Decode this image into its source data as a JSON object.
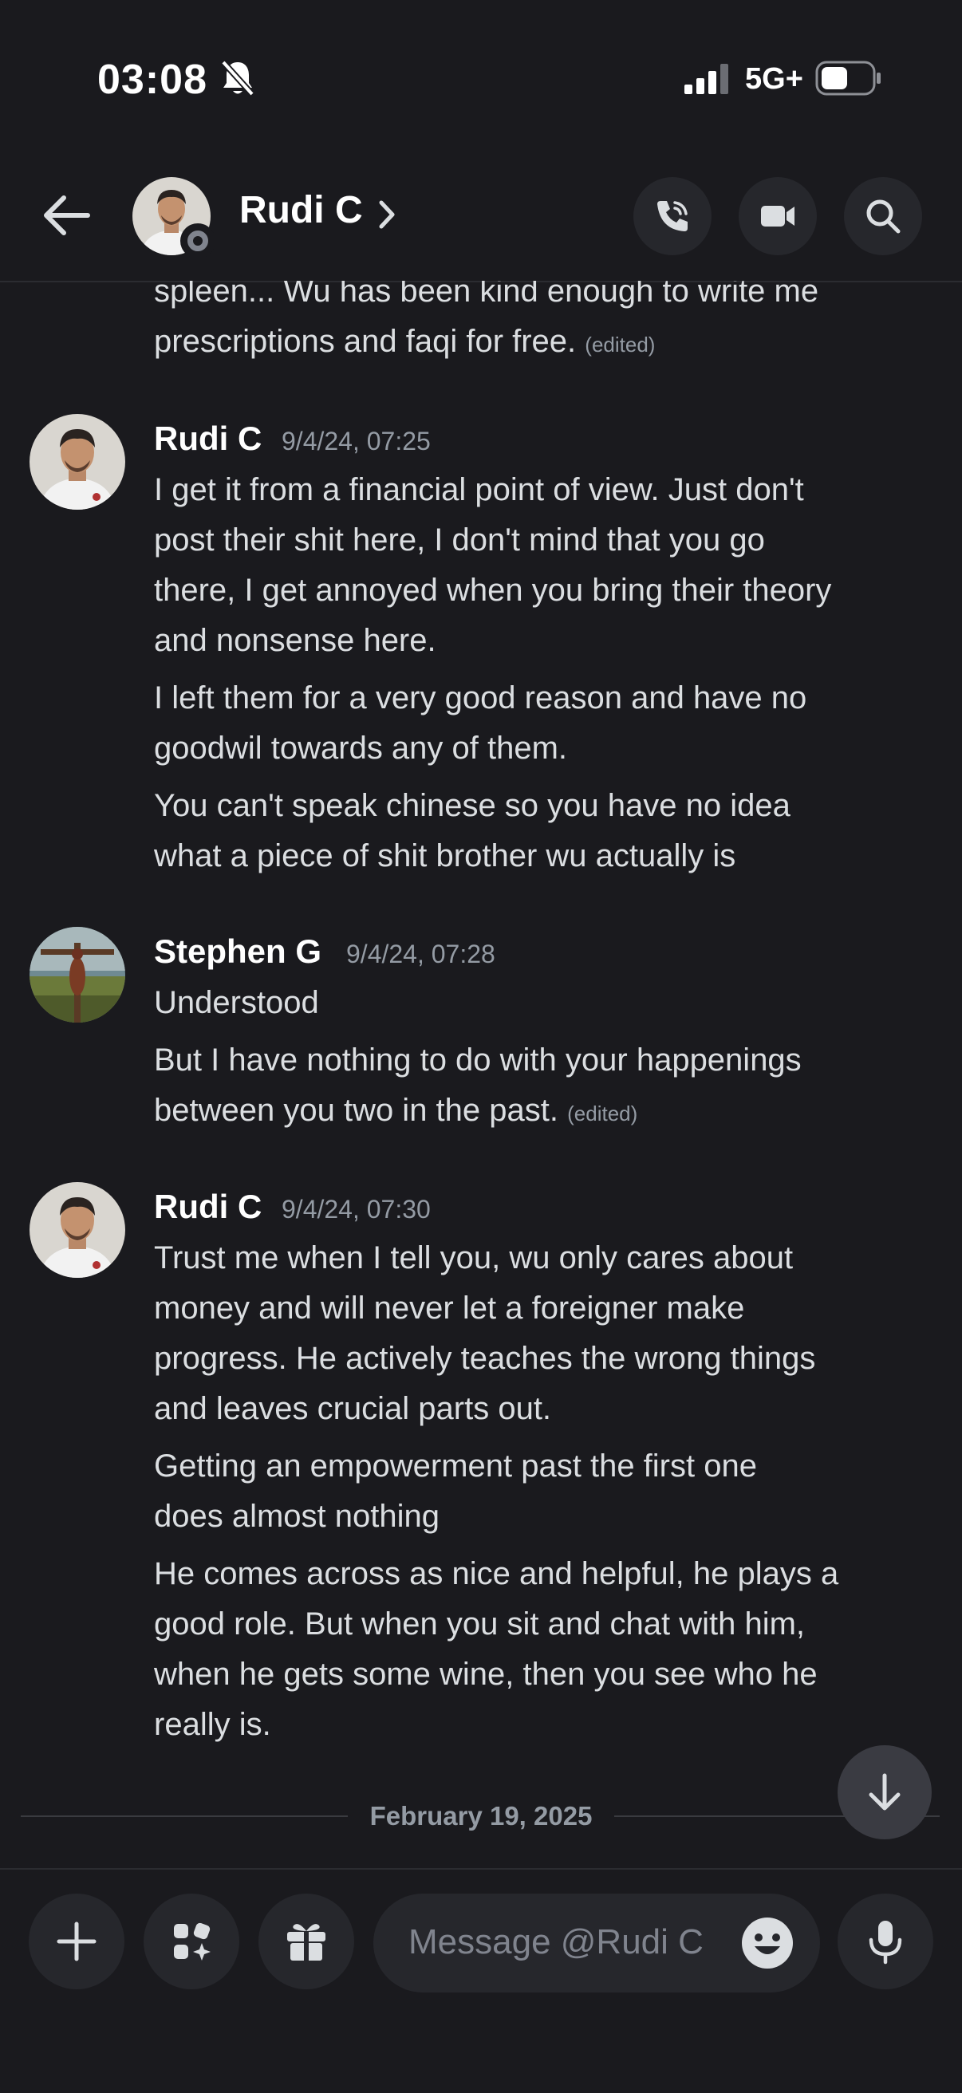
{
  "status_bar": {
    "time": "03:08",
    "network": "5G+"
  },
  "header": {
    "name": "Rudi C"
  },
  "messages": {
    "m0": {
      "line1": "spleen... Wu has been kind enough to write me",
      "line2": "prescriptions and faqi for free.",
      "edited": "(edited)"
    },
    "m1": {
      "author": "Rudi C",
      "timestamp": "9/4/24, 07:25",
      "p1": [
        "I get it from a financial point of view. Just don't",
        "post their shit here, I don't mind that you go",
        "there, I get annoyed when you bring their theory",
        "and nonsense here."
      ],
      "p2": [
        "I left them for a very good reason and have no",
        "goodwil towards any of them."
      ],
      "p3": [
        "You can't speak chinese so you have no idea",
        "what a piece of shit brother wu actually is"
      ]
    },
    "m2": {
      "author": "Stephen G",
      "timestamp": "9/4/24, 07:28",
      "p1": "Understood",
      "p2": [
        "But I have nothing to do with your happenings",
        "between you two in the past."
      ],
      "edited": "(edited)"
    },
    "m3": {
      "author": "Rudi C",
      "timestamp": "9/4/24, 07:30",
      "p1": [
        "Trust me when I tell you, wu only cares about",
        "money and will never let a foreigner make",
        "progress. He actively teaches the wrong things",
        "and leaves crucial parts out."
      ],
      "p2": [
        "Getting an empowerment past the first one",
        "does almost nothing"
      ],
      "p3": [
        "He comes across as nice and helpful, he plays a",
        "good role. But when you sit and chat with him,",
        "when he gets some wine, then you see who he",
        "really is."
      ]
    }
  },
  "date_divider": "February 19, 2025",
  "composer": {
    "placeholder": "Message @Rudi C"
  },
  "colors": {
    "background": "#1a1a1e",
    "button_bg": "#26272c",
    "text": "#dbdee1",
    "muted": "#949ba4"
  }
}
